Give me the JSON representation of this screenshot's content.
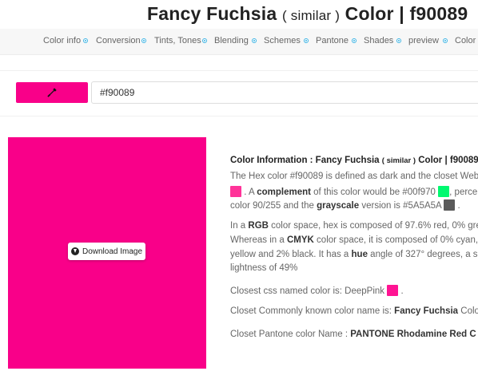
{
  "page_title": {
    "name": "Fancy Fuchsia",
    "qualifier": "( similar )",
    "rest": "Color | f90089"
  },
  "nav": {
    "items": [
      "Color info",
      "Conversion",
      "Tints, Tones",
      "Blending",
      "Schemes",
      "Pantone",
      "Shades",
      "preview",
      "Color F"
    ]
  },
  "picker": {
    "button_color": "#f90089",
    "input_value": "#f90089",
    "icon": "eyedropper-icon"
  },
  "swatch": {
    "color": "#f90089",
    "download_label": "Download Image",
    "download_icon": "download-icon"
  },
  "info": {
    "title_prefix": "Color Information : Fancy Fuchsia",
    "title_qualifier": "( similar )",
    "title_suffix": "Color | f90089",
    "p1_l1": "The Hex color #f90089 is defined as dark and the closet Web",
    "p1_l2a": ". A",
    "p1_l2b": "complement",
    "p1_l2c": "of this color would be #00f970",
    "p1_l2d": ", perce",
    "p1_l3a": "color 90/255 and the",
    "p1_l3b": "grayscale",
    "p1_l3c": "version is #5A5A5A",
    "p1_l3d": ".",
    "p2_l1a": "In a",
    "p2_l1b": "RGB",
    "p2_l1c": "color space, hex is composed of 97.6% red, 0% gree",
    "p2_l2a": "Whereas in a",
    "p2_l2b": "CMYK",
    "p2_l2c": "color space, it is composed of 0% cyan, 1",
    "p2_l3a": "yellow and 2% black. It has a",
    "p2_l3b": "hue",
    "p2_l3c": "angle of 327° degrees, a sat",
    "p2_l4": "lightness of 49%",
    "css_label": "Closest css named color is: DeepPink",
    "css_end": ".",
    "common_label": "Closet Commonly known color name is:",
    "common_value": "Fancy Fuchsia",
    "common_tail": "Color",
    "pantone_label": "Closet Pantone color Name :",
    "pantone_value": "PANTONE Rhodamine Red C",
    "colors": {
      "websafe": "#ff3399",
      "complement": "#00f970",
      "grayscale": "#5a5a5a",
      "deeppink": "#ff1493",
      "pantone": "#e10098"
    }
  }
}
